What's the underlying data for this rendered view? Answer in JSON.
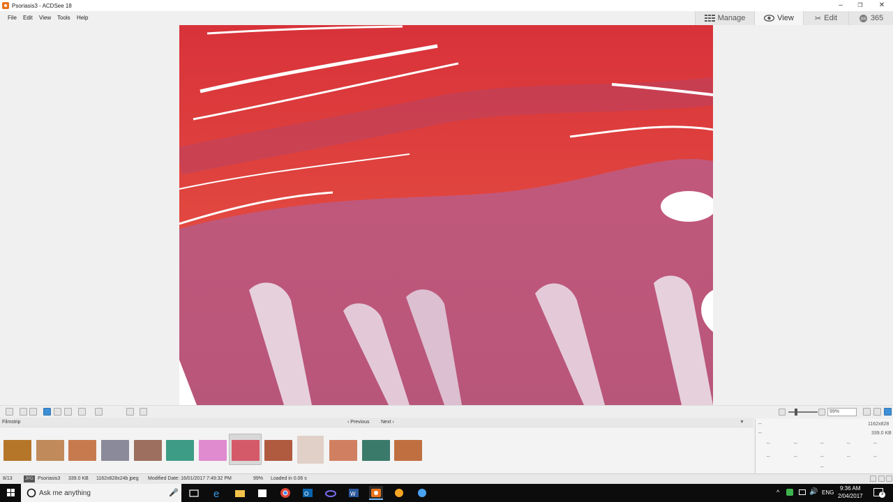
{
  "window": {
    "title": "Psoriasis3 - ACDSee 18",
    "minimize": "–",
    "maximize": "❐",
    "close": "✕"
  },
  "menu": [
    "File",
    "Edit",
    "View",
    "Tools",
    "Help"
  ],
  "modes": [
    {
      "label": "Manage",
      "icon": "grid-icon"
    },
    {
      "label": "View",
      "icon": "eye-icon"
    },
    {
      "label": "Edit",
      "icon": "tools-icon"
    },
    {
      "label": "365",
      "icon": "365-icon"
    }
  ],
  "toolbar": {
    "zoom_value": "99%"
  },
  "filmstrip": {
    "label": "Filmstrip",
    "previous": "Previous",
    "next": "Next",
    "thumbnails": [
      {
        "color": "#b5762a"
      },
      {
        "color": "#c08a5a"
      },
      {
        "color": "#c87a4f"
      },
      {
        "color": "#8a8a9a"
      },
      {
        "color": "#9c6f5e"
      },
      {
        "color": "#3d9c85"
      },
      {
        "color": "#e08ad0"
      },
      {
        "color": "#d45a6a"
      },
      {
        "color": "#b05a40"
      },
      {
        "color": "#e0d0c8"
      },
      {
        "color": "#d08060"
      },
      {
        "color": "#3a7a6a"
      },
      {
        "color": "#c07040"
      }
    ]
  },
  "info_panel": {
    "dimensions": "1162x828",
    "size": "339.0 KB",
    "placeholder": "--"
  },
  "status": {
    "index": "8/13",
    "type": "JPG",
    "filename": "Psoriasis3",
    "filesize": "339.0 KB",
    "details": "1162x828x24b jpeg",
    "modified": "Modified Date: 16/01/2017 7:49:32 PM",
    "zoom": "99%",
    "loaded": "Loaded in 0.06 s"
  },
  "taskbar": {
    "search_placeholder": "Ask me anything",
    "language": "ENG",
    "time": "9:36 AM",
    "date": "2/04/2017",
    "notifications": "3"
  }
}
